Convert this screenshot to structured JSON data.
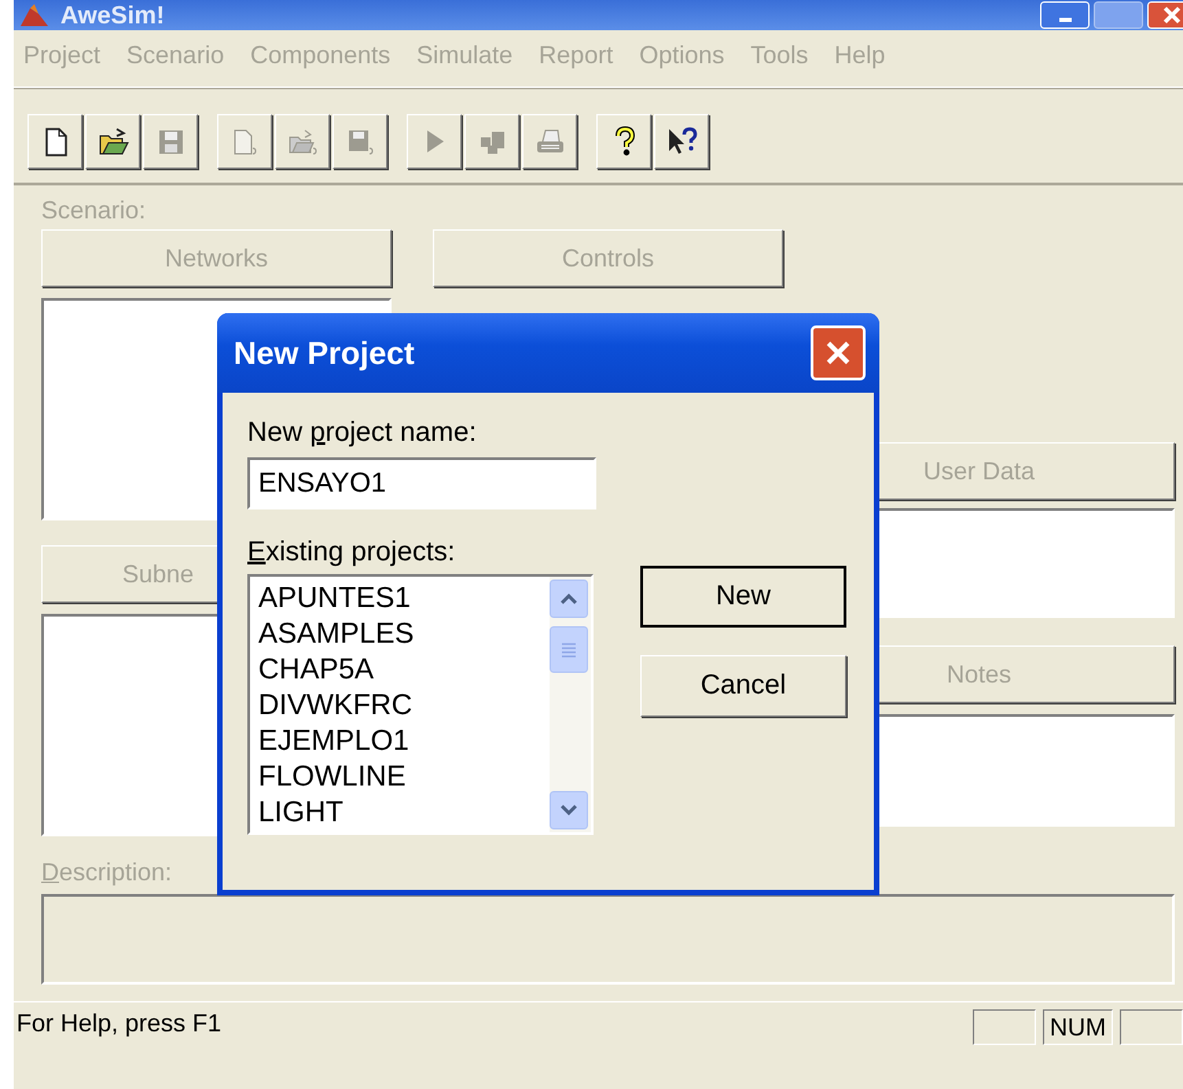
{
  "window": {
    "title": "AweSim!"
  },
  "menu": [
    {
      "label": "Project",
      "disabled": true
    },
    {
      "label": "Scenario",
      "disabled": true
    },
    {
      "label": "Components",
      "disabled": true
    },
    {
      "label": "Simulate",
      "disabled": true
    },
    {
      "label": "Report",
      "disabled": true
    },
    {
      "label": "Options",
      "disabled": true
    },
    {
      "label": "Tools",
      "disabled": true
    },
    {
      "label": "Help",
      "disabled": true
    }
  ],
  "toolbar": [
    [
      {
        "kind": "new",
        "disabled": false
      },
      {
        "kind": "open",
        "disabled": false
      },
      {
        "kind": "save",
        "disabled": true
      }
    ],
    [
      {
        "kind": "scenario-new",
        "disabled": true
      },
      {
        "kind": "scenario-open",
        "disabled": true
      },
      {
        "kind": "scenario-save",
        "disabled": true
      }
    ],
    [
      {
        "kind": "run",
        "disabled": true
      },
      {
        "kind": "network",
        "disabled": true
      },
      {
        "kind": "print",
        "disabled": true
      }
    ],
    [
      {
        "kind": "help",
        "disabled": false
      },
      {
        "kind": "context-help",
        "disabled": false
      }
    ]
  ],
  "scenario": {
    "label": "Scenario:",
    "networks_button": {
      "label": "Networks",
      "disabled": true
    },
    "controls_button": {
      "label": "Controls",
      "disabled": true
    },
    "subnetworks_button": {
      "label": "Subne",
      "disabled": true
    },
    "user_data_button": {
      "label": "User Data",
      "disabled": true
    },
    "notes_button": {
      "label": "Notes",
      "disabled": true
    },
    "description_label": {
      "key": "D",
      "after": "escription:"
    }
  },
  "dialog": {
    "title": "New Project",
    "name_label": {
      "before": "New ",
      "key": "p",
      "after": "roject name:"
    },
    "name_value": "ENSAYO1",
    "existing_label": {
      "key": "E",
      "after": "xisting projects:"
    },
    "projects": [
      "APUNTES1",
      "ASAMPLES",
      "CHAP5A",
      "DIVWKFRC",
      "EJEMPLO1",
      "FLOWLINE",
      "LIGHT"
    ],
    "buttons": [
      {
        "label": "New",
        "default": true
      },
      {
        "label": "Cancel",
        "default": false
      }
    ]
  },
  "status_bar": {
    "text": "For Help, press F1",
    "num_indicator": "NUM"
  }
}
